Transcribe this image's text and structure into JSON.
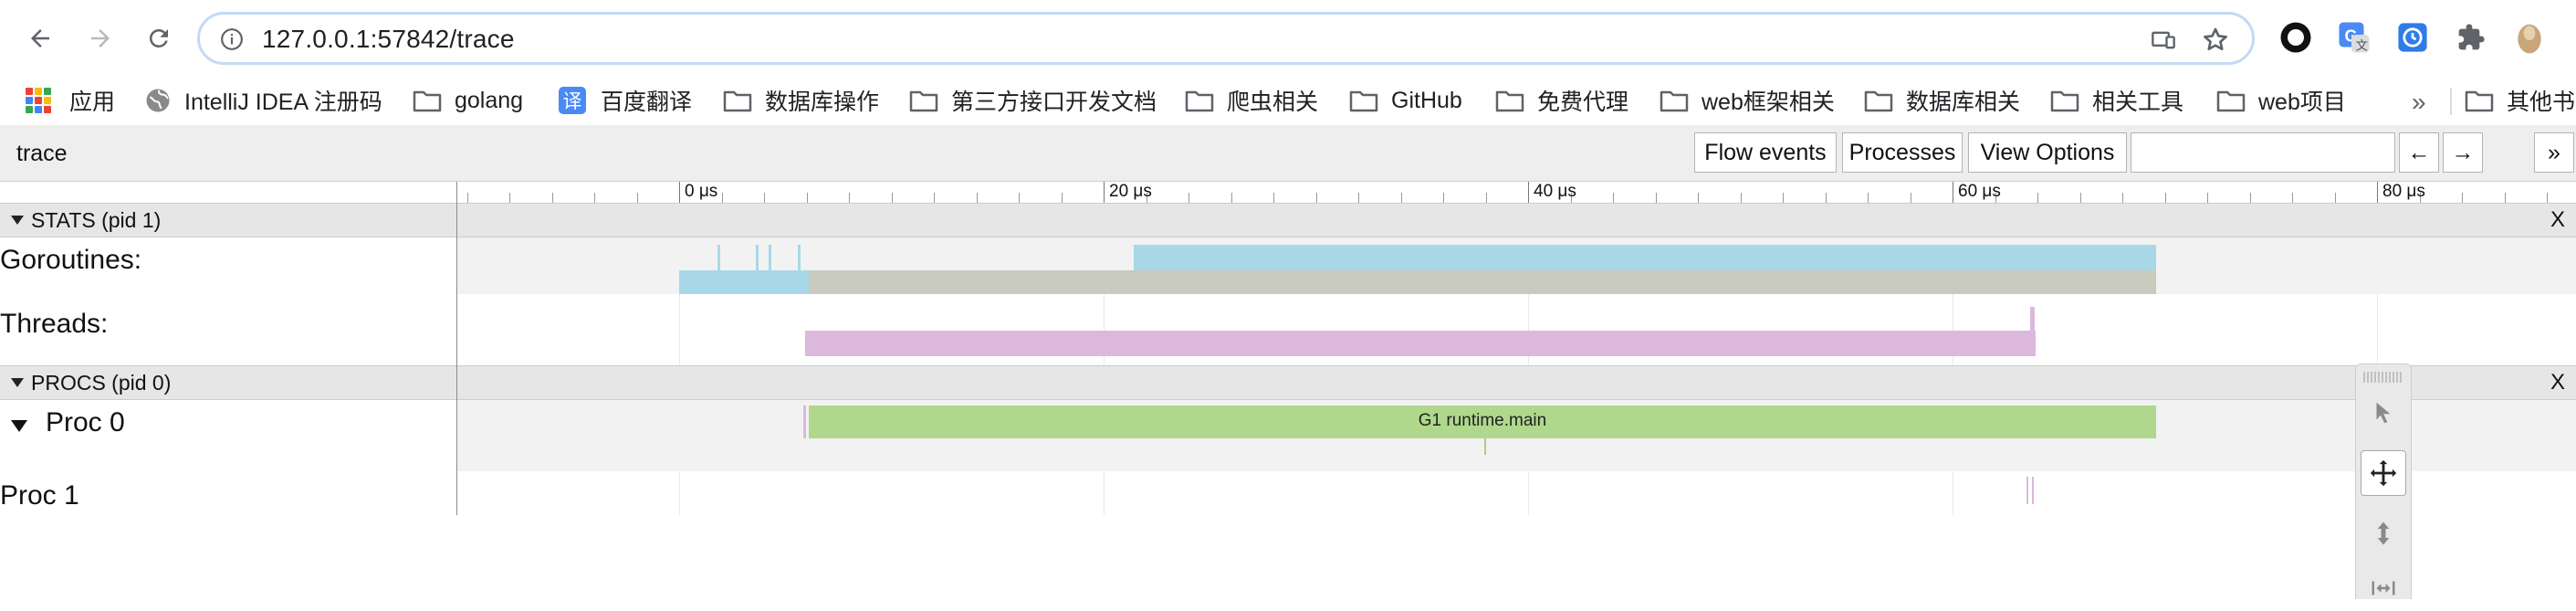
{
  "browser": {
    "url": "127.0.0.1:57842/trace",
    "bookmarks": [
      {
        "label": "应用",
        "icon": "apps-grid-icon"
      },
      {
        "label": "IntelliJ IDEA 注册码",
        "icon": "globe-icon"
      },
      {
        "label": "golang",
        "icon": "folder-icon"
      },
      {
        "label": "百度翻译",
        "icon": "translate-icon"
      },
      {
        "label": "数据库操作",
        "icon": "folder-icon"
      },
      {
        "label": "第三方接口开发文档",
        "icon": "folder-icon"
      },
      {
        "label": "爬虫相关",
        "icon": "folder-icon"
      },
      {
        "label": "GitHub",
        "icon": "folder-icon"
      },
      {
        "label": "免费代理",
        "icon": "folder-icon"
      },
      {
        "label": "web框架相关",
        "icon": "folder-icon"
      },
      {
        "label": "数据库相关",
        "icon": "folder-icon"
      },
      {
        "label": "相关工具",
        "icon": "folder-icon"
      },
      {
        "label": "web项目",
        "icon": "folder-icon"
      }
    ],
    "more_bookmarks": "»",
    "other_bookmarks": "其他书",
    "translate_glyph": "译"
  },
  "trace": {
    "title": "trace",
    "buttons": {
      "flow_events": "Flow events",
      "processes": "Processes",
      "view_options": "View Options",
      "back": "←",
      "forward": "→",
      "more": "»"
    },
    "ruler": {
      "labels": [
        "0 μs",
        "20 μs",
        "40 μs",
        "60 μs",
        "80 μs"
      ]
    },
    "stats_group": {
      "label": "STATS (pid 1)",
      "close": "X"
    },
    "stats_rows": {
      "goroutines": "Goroutines:",
      "threads": "Threads:"
    },
    "procs_group": {
      "label": "PROCS (pid 0)",
      "close": "X"
    },
    "proc_rows": {
      "proc0": "Proc 0",
      "proc1": "Proc 1"
    },
    "slices": {
      "main": "G1 runtime.main"
    },
    "colors": {
      "goroutines_running": "#a8d8e8",
      "goroutines_runnable": "#c8cbbd",
      "threads": "#dcb8dc",
      "main_slice": "#b0d88c"
    }
  }
}
